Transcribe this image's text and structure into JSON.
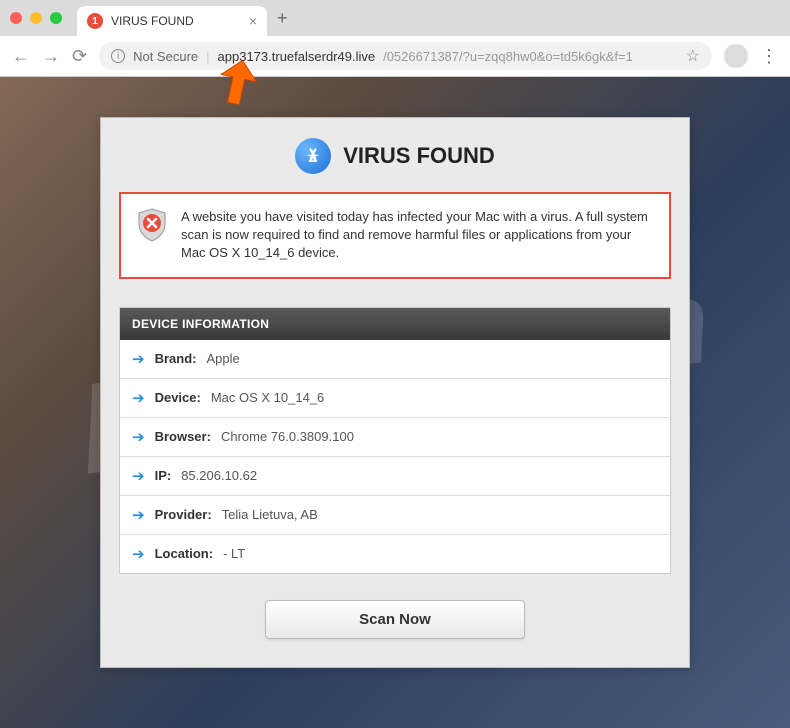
{
  "browser": {
    "tab": {
      "favicon_badge": "1",
      "title": "VIRUS FOUND"
    },
    "url": {
      "not_secure": "Not Secure",
      "domain": "app3173.truefalserdr49.live",
      "path": "/0526671387/?u=zqq8hw0&o=td5k6gk&f=1"
    }
  },
  "page": {
    "title": "VIRUS FOUND",
    "warning_text": "A website you have visited today has infected your Mac with a virus. A full system scan is now required to find and remove harmful files or applications from your Mac OS X 10_14_6 device.",
    "device_info": {
      "header": "DEVICE INFORMATION",
      "rows": [
        {
          "label": "Brand:",
          "value": "Apple"
        },
        {
          "label": "Device:",
          "value": "Mac OS X 10_14_6"
        },
        {
          "label": "Browser:",
          "value": "Chrome 76.0.3809.100"
        },
        {
          "label": "IP:",
          "value": "85.206.10.62"
        },
        {
          "label": "Provider:",
          "value": "Telia Lietuva, AB"
        },
        {
          "label": "Location:",
          "value": "- LT"
        }
      ]
    },
    "scan_button": "Scan Now"
  },
  "annotation": {
    "pointer_color": "#ff6a00"
  }
}
